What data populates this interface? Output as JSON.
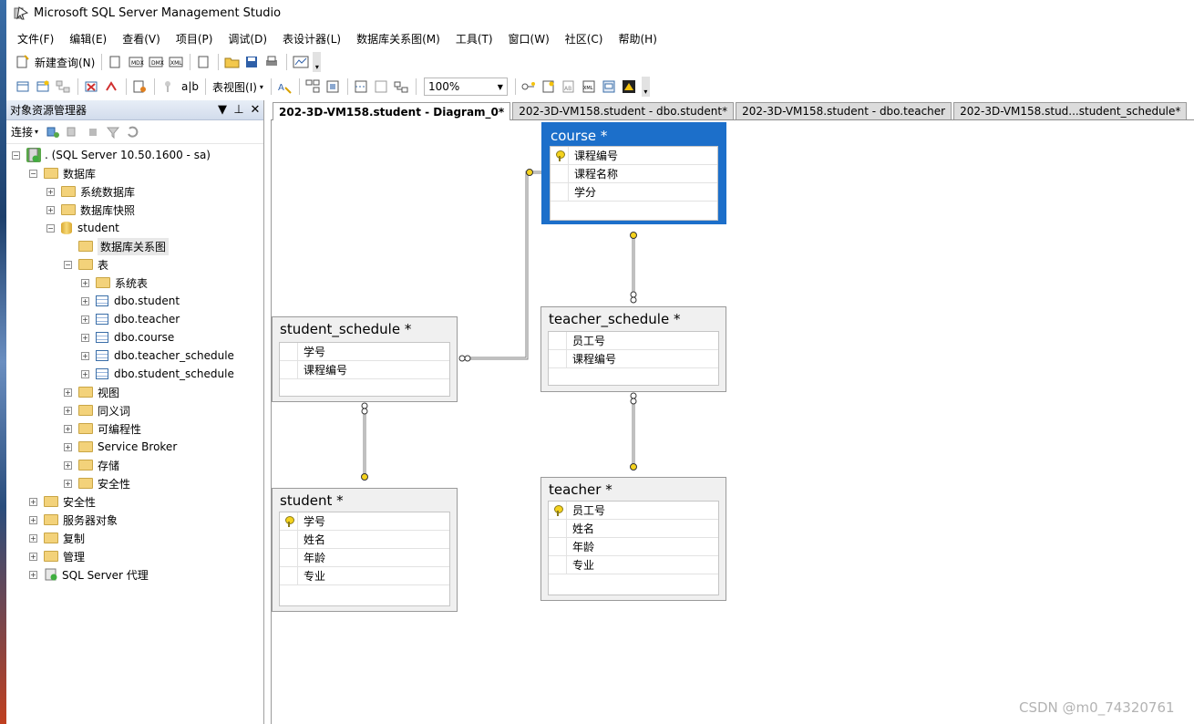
{
  "window": {
    "title": "Microsoft SQL Server Management Studio"
  },
  "menu": [
    "文件(F)",
    "编辑(E)",
    "查看(V)",
    "项目(P)",
    "调试(D)",
    "表设计器(L)",
    "数据库关系图(M)",
    "工具(T)",
    "窗口(W)",
    "社区(C)",
    "帮助(H)"
  ],
  "toolbar": {
    "new_query": "新建查询(N)",
    "table_view": "表视图(I)",
    "zoom": "100%"
  },
  "object_explorer": {
    "title": "对象资源管理器",
    "connect": "连接",
    "tree": {
      "server": ". (SQL Server 10.50.1600 - sa)",
      "databases": "数据库",
      "system_databases": "系统数据库",
      "snapshots": "数据库快照",
      "student_db": "student",
      "diagrams": "数据库关系图",
      "tables": "表",
      "system_tables": "系统表",
      "table_list": [
        "dbo.student",
        "dbo.teacher",
        "dbo.course",
        "dbo.teacher_schedule",
        "dbo.student_schedule"
      ],
      "db_children": [
        "视图",
        "同义词",
        "可编程性",
        "Service Broker",
        "存储",
        "安全性"
      ],
      "root_children": [
        "安全性",
        "服务器对象",
        "复制",
        "管理",
        "SQL Server 代理"
      ]
    }
  },
  "tabs": [
    "202-3D-VM158.student - Diagram_0*",
    "202-3D-VM158.student - dbo.student*",
    "202-3D-VM158.student - dbo.teacher",
    "202-3D-VM158.stud...student_schedule*"
  ],
  "diagram": {
    "course": {
      "title": "course *",
      "cols": [
        "课程编号",
        "课程名称",
        "学分"
      ]
    },
    "teacher_schedule": {
      "title": "teacher_schedule *",
      "cols": [
        "员工号",
        "课程编号"
      ]
    },
    "student_schedule": {
      "title": "student_schedule *",
      "cols": [
        "学号",
        "课程编号"
      ]
    },
    "student": {
      "title": "student *",
      "cols": [
        "学号",
        "姓名",
        "年龄",
        "专业"
      ]
    },
    "teacher": {
      "title": "teacher *",
      "cols": [
        "员工号",
        "姓名",
        "年龄",
        "专业"
      ]
    }
  },
  "watermark": "CSDN @m0_74320761"
}
